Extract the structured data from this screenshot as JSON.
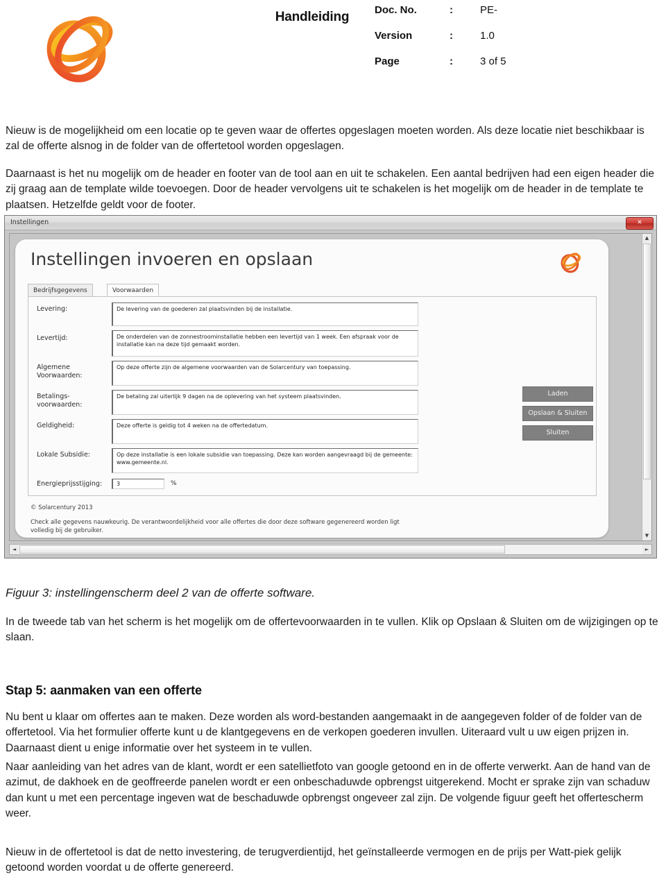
{
  "header": {
    "title": "Handleiding",
    "logo_icon": "solarcentury-knot-logo",
    "meta": [
      {
        "label": "Doc. No.",
        "colon": ":",
        "value": "PE-"
      },
      {
        "label": "Version",
        "colon": ":",
        "value": "1.0"
      },
      {
        "label": "Page",
        "colon": ":",
        "value": "3 of 5"
      }
    ]
  },
  "intro": {
    "paragraph1": "Nieuw is de mogelijkheid om een locatie op te geven waar de offertes opgeslagen moeten worden. Als deze locatie niet beschikbaar is zal de offerte alsnog in de folder van de offertetool worden opgeslagen.",
    "paragraph2": "Daarnaast is het nu mogelijk om de header en footer van de tool aan en uit te schakelen. Een aantal bedrijven had een eigen header die zij graag aan de template wilde toevoegen. Door de header vervolgens uit te schakelen is het mogelijk om de header in de template te plaatsen. Hetzelfde geldt voor de footer."
  },
  "screenshot": {
    "window_title": "Instellingen",
    "close_label": "✕",
    "panel_heading": "Instellingen invoeren en opslaan",
    "panel_logo_icon": "solarcentury-knot-logo",
    "tabs": [
      {
        "label": "Bedrijfsgegevens",
        "active": false
      },
      {
        "label": "Voorwaarden",
        "active": true
      }
    ],
    "fields": [
      {
        "label": "Levering:",
        "value": "De levering van de goederen zal plaatsvinden bij de installatie."
      },
      {
        "label": "Levertijd:",
        "value": "De onderdelen van de zonnestroominstallatie hebben een levertijd van 1 week. Een afspraak voor de installatie kan na deze tijd gemaakt worden."
      },
      {
        "label": "Algemene Voorwaarden:",
        "value": "Op deze offerte zijn de algemene voorwaarden van de Solarcentury van toepassing."
      },
      {
        "label": "Betalings- voorwaarden:",
        "value": "De betaling zal uiterlijk 9 dagen na de oplevering van het systeem plaatsvinden."
      },
      {
        "label": "Geldigheid:",
        "value": "Deze offerte is geldig tot 4 weken na de offertedatum."
      },
      {
        "label": "Lokale Subsidie:",
        "value": "Op deze installatie is een lokale subsidie van toepassing. Deze kan worden aangevraagd bij de gemeente: www.gemeente.nl."
      }
    ],
    "energy_field": {
      "label": "Energieprijsstijging:",
      "value": "3",
      "unit": "%"
    },
    "buttons": [
      {
        "label": "Laden"
      },
      {
        "label": "Opslaan & Sluiten"
      },
      {
        "label": "Sluiten"
      }
    ],
    "copyright": "© Solarcentury 2013",
    "disclaimer": "Check alle gegevens nauwkeurig. De verantwoordelijkheid voor alle offertes die door deze software gegenereerd worden ligt volledig bij de gebruiker.",
    "scroll_up_icon": "▲",
    "scroll_down_icon": "▼",
    "scroll_left_icon": "◄",
    "scroll_right_icon": "►"
  },
  "figure": {
    "caption": "Figuur 3: instellingenscherm deel 2 van de offerte software.",
    "description": "In de tweede tab van het scherm is het mogelijk om de offertevoorwaarden in te vullen. Klik op Opslaan & Sluiten om de wijzigingen op te slaan."
  },
  "step5": {
    "heading": "Stap 5: aanmaken van een offerte",
    "paragraph1": "Nu bent u klaar om offertes aan te maken. Deze worden als word-bestanden aangemaakt in de aangegeven folder of de folder van de offertetool. Via het formulier offerte kunt u de klantgegevens en de verkopen goederen invullen. Uiteraard vult u uw eigen prijzen in. Daarnaast dient u enige informatie over het systeem in te vullen.",
    "paragraph2": "Naar aanleiding van het adres van de klant, wordt er een satellietfoto van google getoond en in de offerte verwerkt. Aan de hand  van de azimut, de dakhoek en de geoffreerde panelen wordt er een onbeschaduwde opbrengst uitgerekend. Mocht er sprake zijn van schaduw dan kunt u met een percentage ingeven wat de beschaduwde opbrengst ongeveer zal zijn. De volgende figuur geeft het offertescherm weer.",
    "paragraph3": "Nieuw in de offertetool is dat de netto investering, de terugverdientijd, het geïnstalleerde vermogen en de prijs per Watt-piek gelijk getoond worden voordat u de offerte genereerd."
  },
  "colors": {
    "logo_orange": "#F59B1C",
    "logo_red": "#E8442B",
    "logo_amber": "#F5A623",
    "close_red": "#C8342A"
  }
}
